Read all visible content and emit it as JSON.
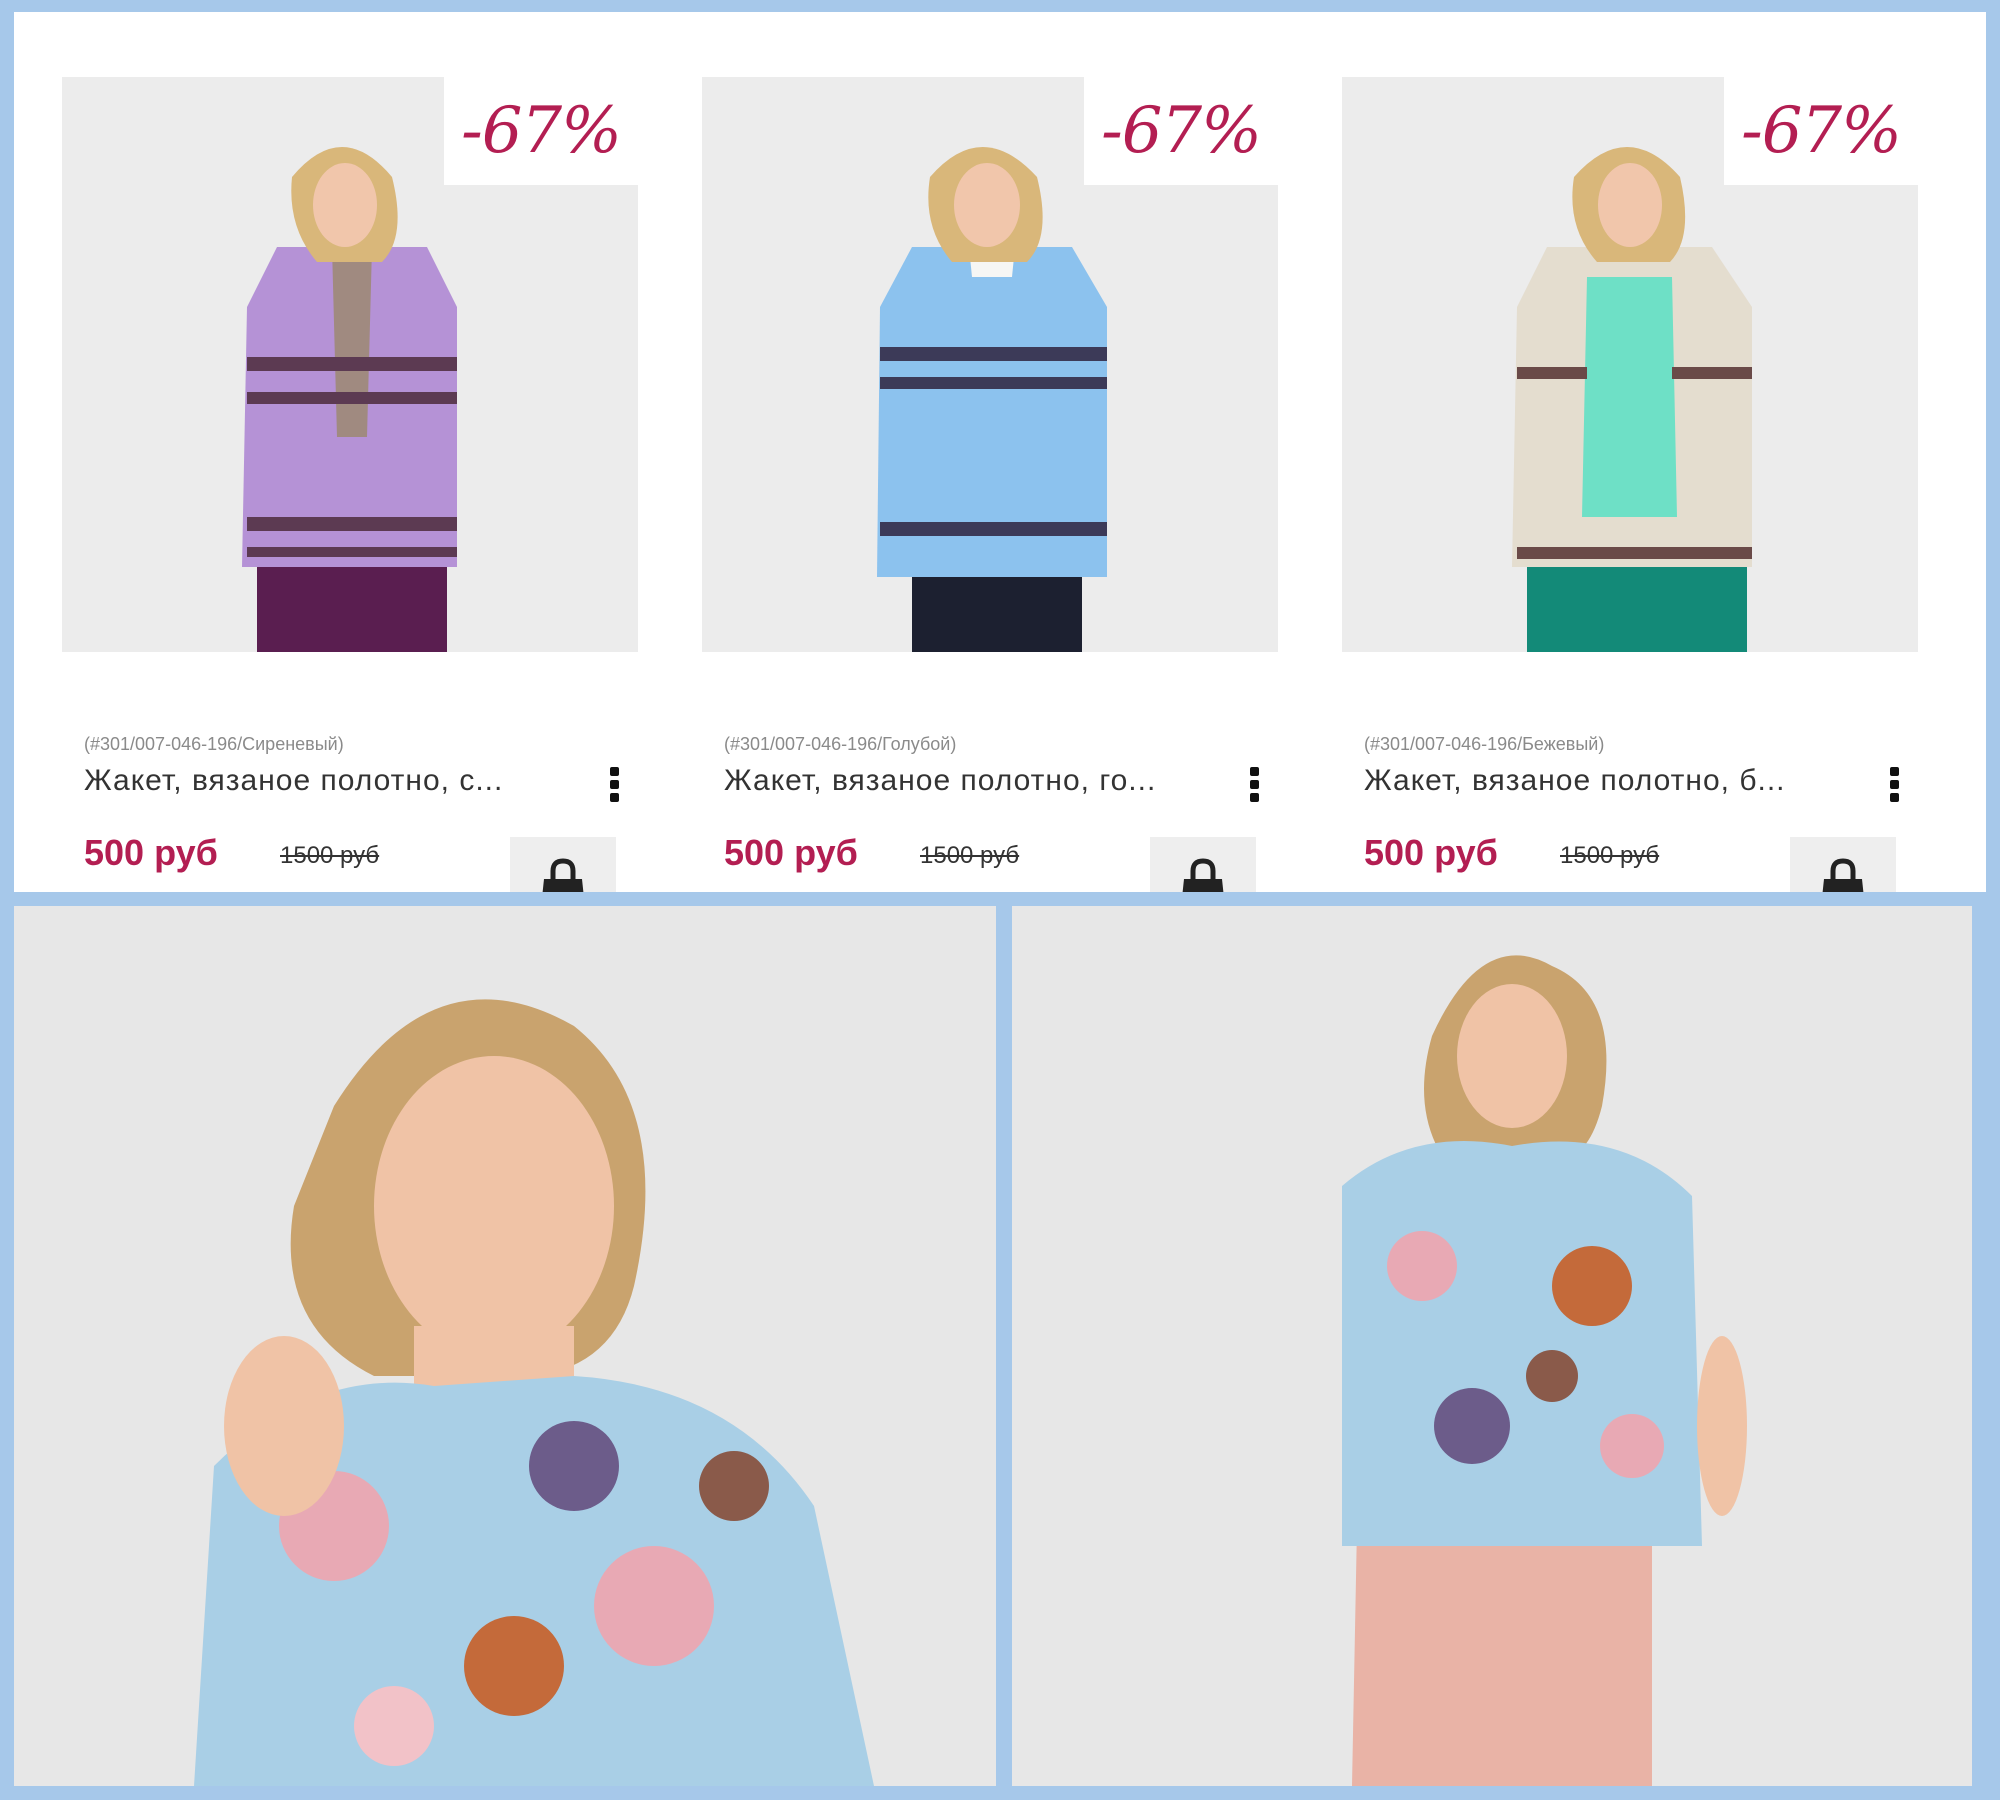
{
  "products": [
    {
      "sku": "(#301/007-046-196/Сиреневый)",
      "title": "Жакет, вязаное полотно, с...",
      "price": "500 руб",
      "old_price": "1500 руб",
      "discount": "-67%",
      "colors": {
        "garment": "#b592d6",
        "stripe": "#5c3a52",
        "under": "#a08a80",
        "bottom": "#5a1e50"
      }
    },
    {
      "sku": "(#301/007-046-196/Голубой)",
      "title": "Жакет, вязаное полотно, го...",
      "price": "500 руб",
      "old_price": "1500 руб",
      "discount": "-67%",
      "colors": {
        "garment": "#8cc2ee",
        "stripe": "#3c3a58",
        "under": "#f6f6f4",
        "bottom": "#1c2030"
      }
    },
    {
      "sku": "(#301/007-046-196/Бежевый)",
      "title": "Жакет, вязаное полотно, б...",
      "price": "500 руб",
      "old_price": "1500 руб",
      "discount": "-67%",
      "colors": {
        "garment": "#e4ddcf",
        "stripe": "#6a4a48",
        "under": "#6ee0c6",
        "bottom": "#138a78"
      }
    }
  ],
  "theme": {
    "accent": "#b31e52",
    "frame": "#a6c8ea"
  },
  "icons": {
    "cart": "shopping-bag-icon",
    "more": "more-vertical-icon"
  }
}
